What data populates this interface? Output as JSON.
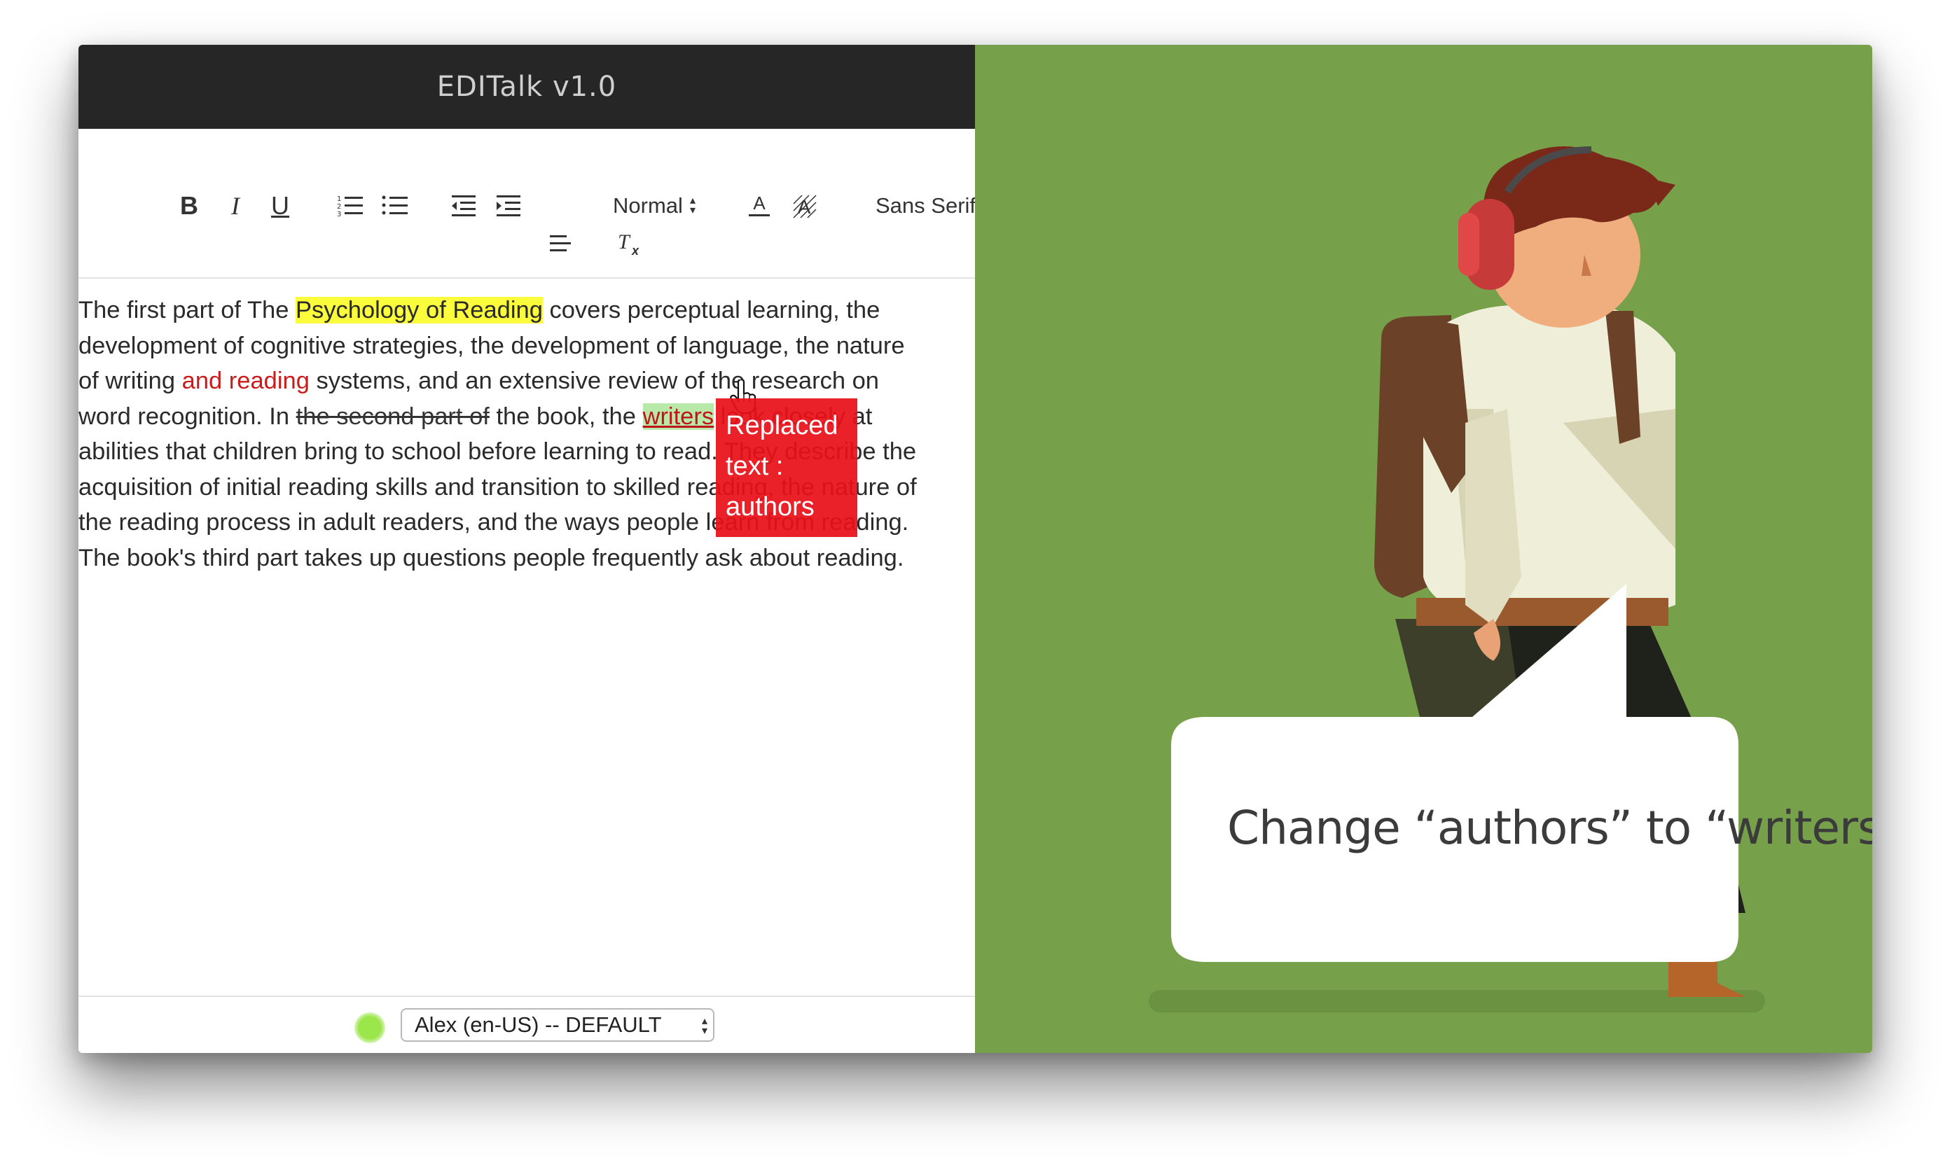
{
  "app": {
    "title": "EDITalk v1.0"
  },
  "toolbar": {
    "bold_label": "B",
    "italic_label": "I",
    "underline_label": "U",
    "heading_select": "Normal",
    "font_select": "Sans Serif"
  },
  "editor": {
    "lines": [
      [
        {
          "t": "The first part of The "
        },
        {
          "t": "Psychology of Reading",
          "s": "hl-yellow"
        },
        {
          "t": " covers perceptual learning, the"
        }
      ],
      [
        {
          "t": "development of cognitive strategies, the development of language, the nature"
        }
      ],
      [
        {
          "t": "of writing "
        },
        {
          "t": "and reading",
          "s": "red-text"
        },
        {
          "t": " systems, and an extensive review of the research on"
        }
      ],
      [
        {
          "t": "word recognition. In "
        },
        {
          "t": "the second part of",
          "s": "struck"
        },
        {
          "t": " the book, the "
        },
        {
          "t": "writers",
          "s": "hl-green"
        },
        {
          "t": " look closely at"
        }
      ],
      [
        {
          "t": "abilities that children bring to school before learning to read. They describe the"
        }
      ],
      [
        {
          "t": "acquisition of initial reading skills and transition to skilled reading, the nature of"
        }
      ],
      [
        {
          "t": "the reading process in adult readers, and the ways people learn from reading."
        }
      ],
      [
        {
          "t": "The book's third part takes up questions people frequently ask about reading."
        }
      ]
    ],
    "tooltip_lines": [
      "Replaced",
      "text :",
      "authors"
    ]
  },
  "footer": {
    "status_color": "#9be64a",
    "voice_select": "Alex (en-US) -- DEFAULT"
  },
  "illustration": {
    "speech_bubble": "Change “authors” to “writers”",
    "background_color": "#76a04a"
  }
}
